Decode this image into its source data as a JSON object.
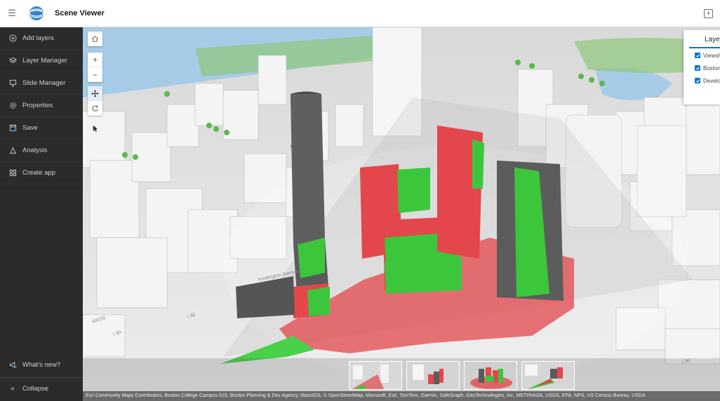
{
  "header": {
    "title": "Scene Viewer",
    "menu_icon": "hamburger-icon",
    "expand_icon": "expand-icon"
  },
  "sidebar": {
    "items": [
      {
        "label": "Add layers",
        "icon": "add-circle-icon"
      },
      {
        "label": "Layer Manager",
        "icon": "layers-icon"
      },
      {
        "label": "Slide Manager",
        "icon": "slides-icon"
      },
      {
        "label": "Properties",
        "icon": "gear-icon"
      },
      {
        "label": "Save",
        "icon": "save-icon"
      },
      {
        "label": "Analysis",
        "icon": "analysis-icon"
      },
      {
        "label": "Create app",
        "icon": "grid-icon"
      }
    ],
    "whats_new": "What's new?",
    "collapse": "Collapse"
  },
  "nav": {
    "home": "home-icon",
    "zoom_in": "+",
    "zoom_out": "−",
    "pan": "pan-icon",
    "rotate": "rotate-icon",
    "pointer": "pointer-icon"
  },
  "layer_panel": {
    "tab": "Layers",
    "layers": [
      "Viewshed",
      "Boston",
      "Development"
    ]
  },
  "attribution": "Esri Community Maps Contributors, Boston College Campus GIS, Boston Planning & Dev Agency, MassGIS, © OpenStreetMap, Microsoft, Esri, TomTom, Garmin, SafeGraph, GeoTechnologies, Inc, METI/NASA, USGS, EPA, NPS, US Census Bureau, USDA",
  "map_labels": {
    "street": "Huntington Avenue",
    "highway_left": "I 90",
    "highway_mid": "I 90",
    "highway_right": "I 90",
    "mass_pike": "MASS"
  },
  "colors": {
    "visible": "#3cc63c",
    "not_visible": "#e3474b",
    "water": "#a6cbe6",
    "tree": "#5bb84e",
    "sidebar": "#2b2b2b"
  }
}
